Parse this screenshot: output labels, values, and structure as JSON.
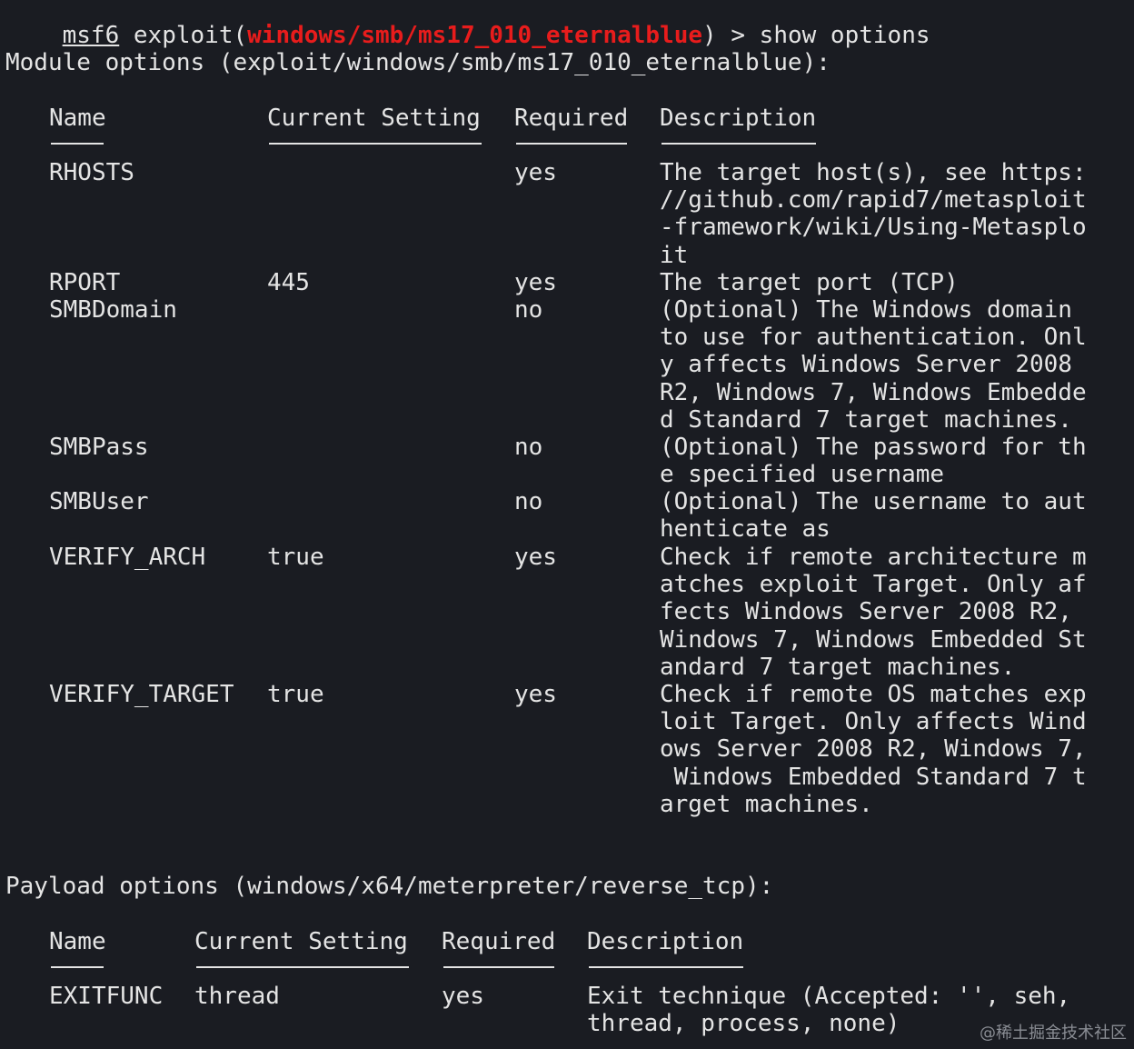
{
  "prompt": {
    "msf": "msf6",
    "exploit_open": " exploit(",
    "module": "windows/smb/ms17_010_eternalblue",
    "exploit_close": ") > show options"
  },
  "module_options": {
    "heading": "Module options (exploit/windows/smb/ms17_010_eternalblue):",
    "headers": [
      "Name",
      "Current Setting",
      "Required",
      "Description"
    ],
    "rows": [
      {
        "name": "RHOSTS",
        "setting": "",
        "required": "yes",
        "description": "The target host(s), see https:\n//github.com/rapid7/metasploit\n-framework/wiki/Using-Metasplo\nit"
      },
      {
        "name": "RPORT",
        "setting": "445",
        "required": "yes",
        "description": "The target port (TCP)"
      },
      {
        "name": "SMBDomain",
        "setting": "",
        "required": "no",
        "description": "(Optional) The Windows domain\nto use for authentication. Onl\ny affects Windows Server 2008\nR2, Windows 7, Windows Embedde\nd Standard 7 target machines."
      },
      {
        "name": "SMBPass",
        "setting": "",
        "required": "no",
        "description": "(Optional) The password for th\ne specified username"
      },
      {
        "name": "SMBUser",
        "setting": "",
        "required": "no",
        "description": "(Optional) The username to aut\nhenticate as"
      },
      {
        "name": "VERIFY_ARCH",
        "setting": "true",
        "required": "yes",
        "description": "Check if remote architecture m\natches exploit Target. Only af\nfects Windows Server 2008 R2,\nWindows 7, Windows Embedded St\nandard 7 target machines."
      },
      {
        "name": "VERIFY_TARGET",
        "setting": "true",
        "required": "yes",
        "description": "Check if remote OS matches exp\nloit Target. Only affects Wind\nows Server 2008 R2, Windows 7,\n Windows Embedded Standard 7 t\narget machines."
      }
    ]
  },
  "payload_options": {
    "heading": "Payload options (windows/x64/meterpreter/reverse_tcp):",
    "headers": [
      "Name",
      "Current Setting",
      "Required",
      "Description"
    ],
    "rows": [
      {
        "name": "EXITFUNC",
        "setting": "thread",
        "required": "yes",
        "description": "Exit technique (Accepted: '', seh,\nthread, process, none)"
      }
    ]
  },
  "watermark": "@稀土掘金技术社区",
  "colors": {
    "background": "#1a1c22",
    "text": "#e4e4e4",
    "module_highlight": "#e81c1c"
  }
}
